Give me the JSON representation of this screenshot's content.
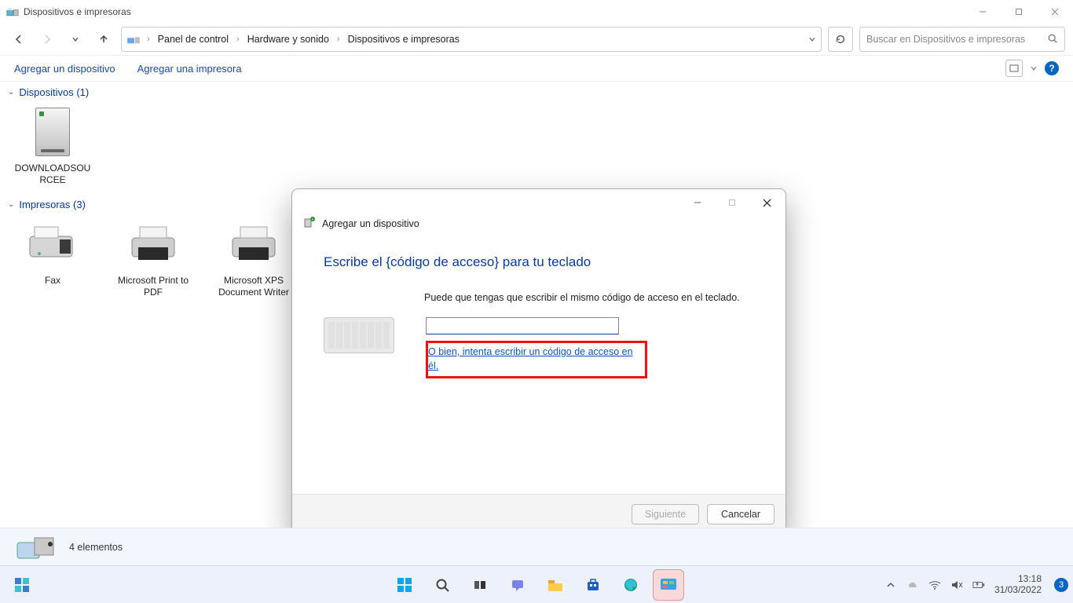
{
  "window": {
    "title": "Dispositivos e impresoras"
  },
  "nav": {
    "crumbs": [
      "Panel de control",
      "Hardware y sonido",
      "Dispositivos e impresoras"
    ]
  },
  "search": {
    "placeholder": "Buscar en Dispositivos e impresoras"
  },
  "toolbar": {
    "add_device": "Agregar un dispositivo",
    "add_printer": "Agregar una impresora"
  },
  "groups": {
    "devices": {
      "header": "Dispositivos (1)",
      "items": [
        {
          "label": "DOWNLOADSOURCEE"
        }
      ]
    },
    "printers": {
      "header": "Impresoras (3)",
      "items": [
        {
          "label": "Fax"
        },
        {
          "label": "Microsoft Print to PDF"
        },
        {
          "label": "Microsoft XPS Document Writer"
        }
      ]
    }
  },
  "status": {
    "text": "4 elementos"
  },
  "dialog": {
    "subtitle": "Agregar un dispositivo",
    "heading": "Escribe el {código de acceso} para tu teclado",
    "hint": "Puede que tengas que escribir el mismo código de acceso en el teclado.",
    "code_value": "",
    "alt_link": "O bien, intenta escribir un código de acceso en él.",
    "next": "Siguiente",
    "cancel": "Cancelar"
  },
  "taskbar": {
    "time": "13:18",
    "date": "31/03/2022",
    "notif_count": "3"
  }
}
